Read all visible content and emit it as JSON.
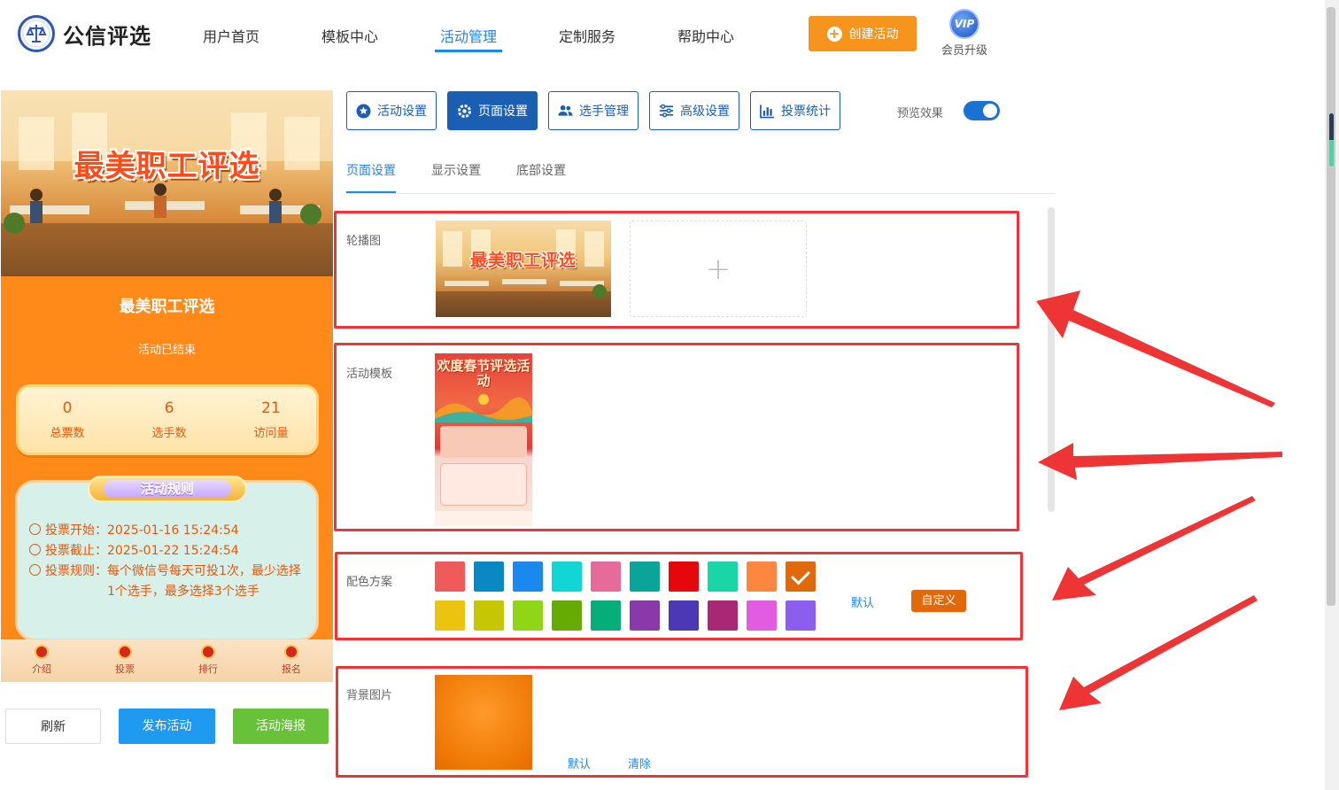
{
  "header": {
    "logo_text": "公信评选",
    "nav": [
      "用户首页",
      "模板中心",
      "活动管理",
      "定制服务",
      "帮助中心"
    ],
    "active_nav": "活动管理",
    "create_button": "创建活动",
    "vip_badge": "VIP",
    "vip_label": "会员升级"
  },
  "preview": {
    "banner_title": "最美职工评选",
    "activity_title": "最美职工评选",
    "status": "活动已结束",
    "stats": [
      {
        "value": "0",
        "label": "总票数"
      },
      {
        "value": "6",
        "label": "选手数"
      },
      {
        "value": "21",
        "label": "访问量"
      }
    ],
    "rules_title": "活动规则",
    "rules": {
      "start": "投票开始：2025-01-16 15:24:54",
      "end": "投票截止：2025-01-22 15:24:54",
      "rule_line1": "投票规则：每个微信号每天可投1次，最少选择",
      "rule_line2": "1个选手，最多选择3个选手"
    },
    "tabs": [
      "介绍",
      "投票",
      "排行",
      "报名"
    ]
  },
  "actions": {
    "refresh": "刷新",
    "publish": "发布活动",
    "poster": "活动海报"
  },
  "toolbar": {
    "buttons": [
      "活动设置",
      "页面设置",
      "选手管理",
      "高级设置",
      "投票统计"
    ],
    "active": "页面设置",
    "preview_label": "预览效果",
    "preview_on": true
  },
  "subtabs": [
    "页面设置",
    "显示设置",
    "底部设置"
  ],
  "sections": {
    "carousel_label": "轮播图",
    "carousel_image_title": "最美职工评选",
    "template_label": "活动模板",
    "template_title": "欢度春节评选活动",
    "color_label": "配色方案",
    "color_default": "默认",
    "color_custom": "自定义",
    "bg_label": "背景图片",
    "bg_default": "默认",
    "bg_clear": "清除"
  },
  "colors": {
    "row1": [
      "#f05a5a",
      "#0a88c4",
      "#1a88ee",
      "#12d6d6",
      "#e76b9a",
      "#0aa598",
      "#e6060b",
      "#1ad5a5",
      "#ff8641",
      "#e2680c"
    ],
    "row2": [
      "#eac40e",
      "#c6c603",
      "#8fd617",
      "#65ab04",
      "#04ae78",
      "#8a39ab",
      "#4c37b5",
      "#a82875",
      "#e25ce2",
      "#8c5ef0"
    ],
    "selected": "#e2680c",
    "accent": "#1e88e5",
    "highlight_red": "#ee3434"
  }
}
